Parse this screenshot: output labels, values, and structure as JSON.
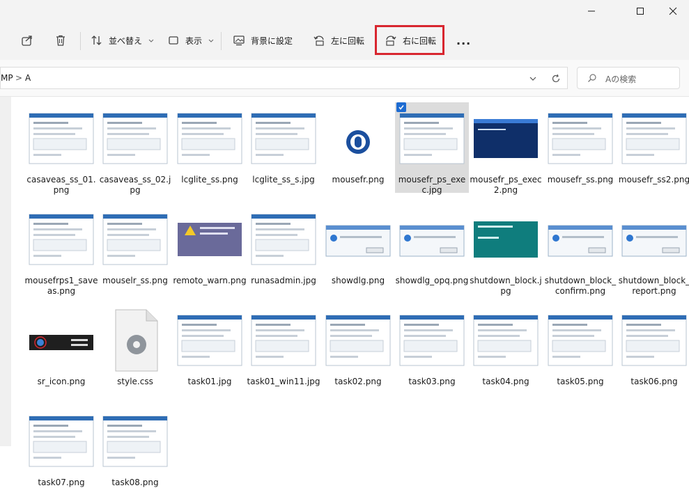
{
  "window": {
    "minimize_icon": "minimize-icon",
    "maximize_icon": "maximize-icon",
    "close_icon": "close-icon"
  },
  "toolbar": {
    "share_icon": "share-icon",
    "delete_icon": "trash-icon",
    "sort_label": "並べ替え",
    "view_label": "表示",
    "background_label": "背景に設定",
    "rotate_left_label": "左に回転",
    "rotate_right_label": "右に回転",
    "more_label": "..."
  },
  "address": {
    "path_text": "MP",
    "separator": ">",
    "current_folder": "A"
  },
  "search": {
    "placeholder": "Aの検索"
  },
  "files": [
    {
      "name": "casaveas_ss_01.png",
      "thumb": "screenshot"
    },
    {
      "name": "casaveas_ss_02.jpg",
      "thumb": "screenshot"
    },
    {
      "name": "lcglite_ss.png",
      "thumb": "screenshot"
    },
    {
      "name": "lcglite_ss_s.jpg",
      "thumb": "screenshot"
    },
    {
      "name": "mousefr.png",
      "thumb": "mouse-icon"
    },
    {
      "name": "mousefr_ps_exec.jpg",
      "thumb": "screenshot",
      "selected": true
    },
    {
      "name": "mousefr_ps_exec2.png",
      "thumb": "powershell"
    },
    {
      "name": "mousefr_ss.png",
      "thumb": "screenshot"
    },
    {
      "name": "mousefr_ss2.png",
      "thumb": "screenshot"
    },
    {
      "name": "mousefrps1_saveas.png",
      "thumb": "screenshot"
    },
    {
      "name": "mouselr_ss.png",
      "thumb": "screenshot"
    },
    {
      "name": "remoto_warn.png",
      "thumb": "warning"
    },
    {
      "name": "runasadmin.jpg",
      "thumb": "screenshot"
    },
    {
      "name": "showdlg.png",
      "thumb": "dialog"
    },
    {
      "name": "showdlg_opq.png",
      "thumb": "dialog"
    },
    {
      "name": "shutdown_block.jpg",
      "thumb": "teal"
    },
    {
      "name": "shutdown_block_confirm.png",
      "thumb": "dialog"
    },
    {
      "name": "shutdown_block_report.png",
      "thumb": "dialog"
    },
    {
      "name": "sr_icon.png",
      "thumb": "taskbar"
    },
    {
      "name": "style.css",
      "thumb": "gear-file"
    },
    {
      "name": "task01.jpg",
      "thumb": "screenshot"
    },
    {
      "name": "task01_win11.jpg",
      "thumb": "screenshot"
    },
    {
      "name": "task02.png",
      "thumb": "screenshot"
    },
    {
      "name": "task03.png",
      "thumb": "screenshot"
    },
    {
      "name": "task04.png",
      "thumb": "screenshot"
    },
    {
      "name": "task05.png",
      "thumb": "screenshot"
    },
    {
      "name": "task06.png",
      "thumb": "screenshot"
    },
    {
      "name": "task07.png",
      "thumb": "screenshot"
    },
    {
      "name": "task08.png",
      "thumb": "screenshot"
    }
  ],
  "colors": {
    "highlight": "#d8262f",
    "accent": "#1d6bd1",
    "selection": "#dcdcdc"
  }
}
